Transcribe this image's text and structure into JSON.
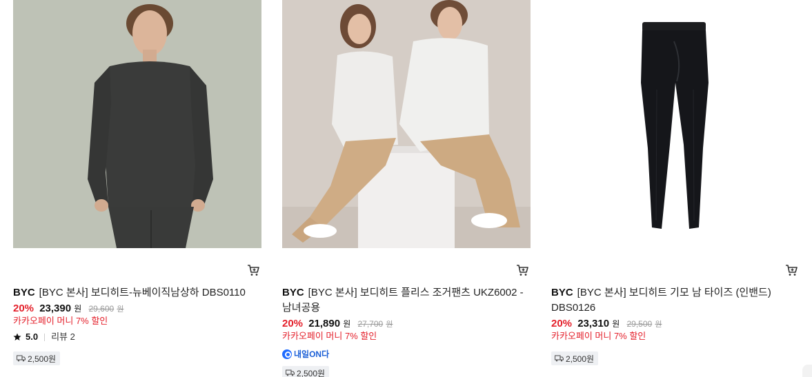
{
  "products": [
    {
      "brand": "BYC",
      "title": "[BYC 본사] 보디히트-뉴베이직남상하 DBS0110",
      "discount": "20%",
      "price": "23,390",
      "price_unit": "원",
      "original_price": "29,600",
      "original_unit": "원",
      "promo": "카카오페이 머니 7% 할인",
      "rating": "5.0",
      "reviews": "리뷰 2",
      "shipping": "2,500원"
    },
    {
      "brand": "BYC",
      "title": "[BYC 본사] 보디히트 플리스 조거팬츠 UKZ6002 - 남녀공용",
      "discount": "20%",
      "price": "21,890",
      "price_unit": "원",
      "original_price": "27,700",
      "original_unit": "원",
      "promo": "카카오페이 머니 7% 할인",
      "delivery_badge": "내일ON다",
      "shipping": "2,500원"
    },
    {
      "brand": "BYC",
      "title": "[BYC 본사] 보디히트 기모 남 타이즈 (인밴드) DBS0126",
      "discount": "20%",
      "price": "23,310",
      "price_unit": "원",
      "original_price": "29,500",
      "original_unit": "원",
      "promo": "카카오페이 머니 7% 할인",
      "shipping": "2,500원"
    }
  ],
  "icons": {
    "cart": "cart-icon",
    "star": "star-icon",
    "truck": "truck-icon",
    "tomorrow": "tomorrow-delivery-icon"
  },
  "colors": {
    "discount": "#e4202b",
    "tomorrow_badge": "#1f6bff",
    "shipping_bg": "#eef0f3"
  }
}
